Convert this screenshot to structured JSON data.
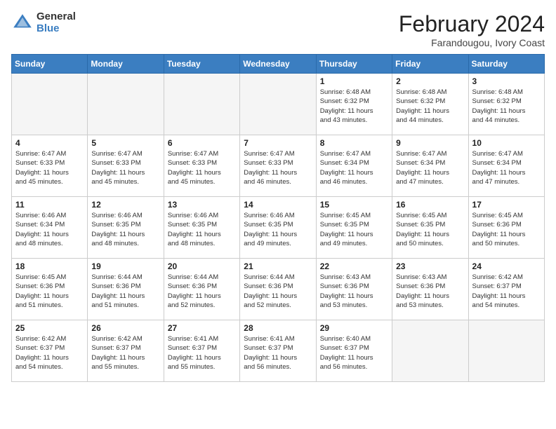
{
  "logo": {
    "general": "General",
    "blue": "Blue"
  },
  "title": "February 2024",
  "subtitle": "Farandougou, Ivory Coast",
  "headers": [
    "Sunday",
    "Monday",
    "Tuesday",
    "Wednesday",
    "Thursday",
    "Friday",
    "Saturday"
  ],
  "weeks": [
    [
      {
        "day": "",
        "info": ""
      },
      {
        "day": "",
        "info": ""
      },
      {
        "day": "",
        "info": ""
      },
      {
        "day": "",
        "info": ""
      },
      {
        "day": "1",
        "info": "Sunrise: 6:48 AM\nSunset: 6:32 PM\nDaylight: 11 hours\nand 43 minutes."
      },
      {
        "day": "2",
        "info": "Sunrise: 6:48 AM\nSunset: 6:32 PM\nDaylight: 11 hours\nand 44 minutes."
      },
      {
        "day": "3",
        "info": "Sunrise: 6:48 AM\nSunset: 6:32 PM\nDaylight: 11 hours\nand 44 minutes."
      }
    ],
    [
      {
        "day": "4",
        "info": "Sunrise: 6:47 AM\nSunset: 6:33 PM\nDaylight: 11 hours\nand 45 minutes."
      },
      {
        "day": "5",
        "info": "Sunrise: 6:47 AM\nSunset: 6:33 PM\nDaylight: 11 hours\nand 45 minutes."
      },
      {
        "day": "6",
        "info": "Sunrise: 6:47 AM\nSunset: 6:33 PM\nDaylight: 11 hours\nand 45 minutes."
      },
      {
        "day": "7",
        "info": "Sunrise: 6:47 AM\nSunset: 6:33 PM\nDaylight: 11 hours\nand 46 minutes."
      },
      {
        "day": "8",
        "info": "Sunrise: 6:47 AM\nSunset: 6:34 PM\nDaylight: 11 hours\nand 46 minutes."
      },
      {
        "day": "9",
        "info": "Sunrise: 6:47 AM\nSunset: 6:34 PM\nDaylight: 11 hours\nand 47 minutes."
      },
      {
        "day": "10",
        "info": "Sunrise: 6:47 AM\nSunset: 6:34 PM\nDaylight: 11 hours\nand 47 minutes."
      }
    ],
    [
      {
        "day": "11",
        "info": "Sunrise: 6:46 AM\nSunset: 6:34 PM\nDaylight: 11 hours\nand 48 minutes."
      },
      {
        "day": "12",
        "info": "Sunrise: 6:46 AM\nSunset: 6:35 PM\nDaylight: 11 hours\nand 48 minutes."
      },
      {
        "day": "13",
        "info": "Sunrise: 6:46 AM\nSunset: 6:35 PM\nDaylight: 11 hours\nand 48 minutes."
      },
      {
        "day": "14",
        "info": "Sunrise: 6:46 AM\nSunset: 6:35 PM\nDaylight: 11 hours\nand 49 minutes."
      },
      {
        "day": "15",
        "info": "Sunrise: 6:45 AM\nSunset: 6:35 PM\nDaylight: 11 hours\nand 49 minutes."
      },
      {
        "day": "16",
        "info": "Sunrise: 6:45 AM\nSunset: 6:35 PM\nDaylight: 11 hours\nand 50 minutes."
      },
      {
        "day": "17",
        "info": "Sunrise: 6:45 AM\nSunset: 6:36 PM\nDaylight: 11 hours\nand 50 minutes."
      }
    ],
    [
      {
        "day": "18",
        "info": "Sunrise: 6:45 AM\nSunset: 6:36 PM\nDaylight: 11 hours\nand 51 minutes."
      },
      {
        "day": "19",
        "info": "Sunrise: 6:44 AM\nSunset: 6:36 PM\nDaylight: 11 hours\nand 51 minutes."
      },
      {
        "day": "20",
        "info": "Sunrise: 6:44 AM\nSunset: 6:36 PM\nDaylight: 11 hours\nand 52 minutes."
      },
      {
        "day": "21",
        "info": "Sunrise: 6:44 AM\nSunset: 6:36 PM\nDaylight: 11 hours\nand 52 minutes."
      },
      {
        "day": "22",
        "info": "Sunrise: 6:43 AM\nSunset: 6:36 PM\nDaylight: 11 hours\nand 53 minutes."
      },
      {
        "day": "23",
        "info": "Sunrise: 6:43 AM\nSunset: 6:36 PM\nDaylight: 11 hours\nand 53 minutes."
      },
      {
        "day": "24",
        "info": "Sunrise: 6:42 AM\nSunset: 6:37 PM\nDaylight: 11 hours\nand 54 minutes."
      }
    ],
    [
      {
        "day": "25",
        "info": "Sunrise: 6:42 AM\nSunset: 6:37 PM\nDaylight: 11 hours\nand 54 minutes."
      },
      {
        "day": "26",
        "info": "Sunrise: 6:42 AM\nSunset: 6:37 PM\nDaylight: 11 hours\nand 55 minutes."
      },
      {
        "day": "27",
        "info": "Sunrise: 6:41 AM\nSunset: 6:37 PM\nDaylight: 11 hours\nand 55 minutes."
      },
      {
        "day": "28",
        "info": "Sunrise: 6:41 AM\nSunset: 6:37 PM\nDaylight: 11 hours\nand 56 minutes."
      },
      {
        "day": "29",
        "info": "Sunrise: 6:40 AM\nSunset: 6:37 PM\nDaylight: 11 hours\nand 56 minutes."
      },
      {
        "day": "",
        "info": ""
      },
      {
        "day": "",
        "info": ""
      }
    ]
  ]
}
